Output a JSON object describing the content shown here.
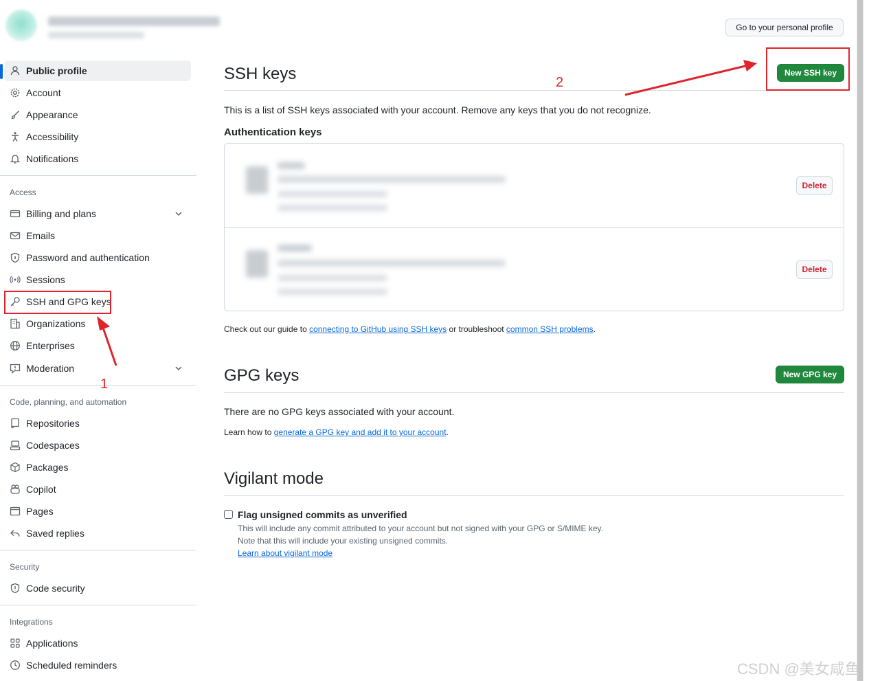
{
  "header": {
    "profile_button": "Go to your personal profile"
  },
  "sidebar": {
    "items_top": [
      {
        "label": "Public profile",
        "icon": "person-icon",
        "active": true
      },
      {
        "label": "Account",
        "icon": "gear-icon"
      },
      {
        "label": "Appearance",
        "icon": "paintbrush-icon"
      },
      {
        "label": "Accessibility",
        "icon": "accessibility-icon"
      },
      {
        "label": "Notifications",
        "icon": "bell-icon"
      }
    ],
    "sections": {
      "access": "Access",
      "code": "Code, planning, and automation",
      "security": "Security",
      "integrations": "Integrations"
    },
    "items_access": [
      {
        "label": "Billing and plans",
        "icon": "credit-card-icon",
        "expandable": true
      },
      {
        "label": "Emails",
        "icon": "mail-icon"
      },
      {
        "label": "Password and authentication",
        "icon": "shield-lock-icon"
      },
      {
        "label": "Sessions",
        "icon": "broadcast-icon"
      },
      {
        "label": "SSH and GPG keys",
        "icon": "key-icon"
      },
      {
        "label": "Organizations",
        "icon": "organization-icon"
      },
      {
        "label": "Enterprises",
        "icon": "globe-icon"
      },
      {
        "label": "Moderation",
        "icon": "report-icon",
        "expandable": true
      }
    ],
    "items_code": [
      {
        "label": "Repositories",
        "icon": "repo-icon"
      },
      {
        "label": "Codespaces",
        "icon": "codespaces-icon"
      },
      {
        "label": "Packages",
        "icon": "package-icon"
      },
      {
        "label": "Copilot",
        "icon": "copilot-icon"
      },
      {
        "label": "Pages",
        "icon": "browser-icon"
      },
      {
        "label": "Saved replies",
        "icon": "reply-icon"
      }
    ],
    "items_security": [
      {
        "label": "Code security",
        "icon": "shield-icon"
      }
    ],
    "items_integrations": [
      {
        "label": "Applications",
        "icon": "apps-icon"
      },
      {
        "label": "Scheduled reminders",
        "icon": "clock-icon"
      }
    ]
  },
  "ssh": {
    "title": "SSH keys",
    "new_button": "New SSH key",
    "description": "This is a list of SSH keys associated with your account. Remove any keys that you do not recognize.",
    "auth_heading": "Authentication keys",
    "delete_label": "Delete",
    "guide_prefix": "Check out our guide to ",
    "guide_link1": "connecting to GitHub using SSH keys",
    "guide_middle": " or troubleshoot ",
    "guide_link2": "common SSH problems",
    "guide_suffix": "."
  },
  "gpg": {
    "title": "GPG keys",
    "new_button": "New GPG key",
    "empty": "There are no GPG keys associated with your account.",
    "learn_prefix": "Learn how to ",
    "learn_link": "generate a GPG key and add it to your account",
    "learn_suffix": "."
  },
  "vigilant": {
    "title": "Vigilant mode",
    "checkbox_label": "Flag unsigned commits as unverified",
    "line1": "This will include any commit attributed to your account but not signed with your GPG or S/MIME key.",
    "line2": "Note that this will include your existing unsigned commits.",
    "link": "Learn about vigilant mode",
    "checked": false
  },
  "annotations": {
    "step1": "1",
    "step2": "2",
    "color": "#e0242b"
  },
  "watermark": "CSDN @美女咸鱼"
}
